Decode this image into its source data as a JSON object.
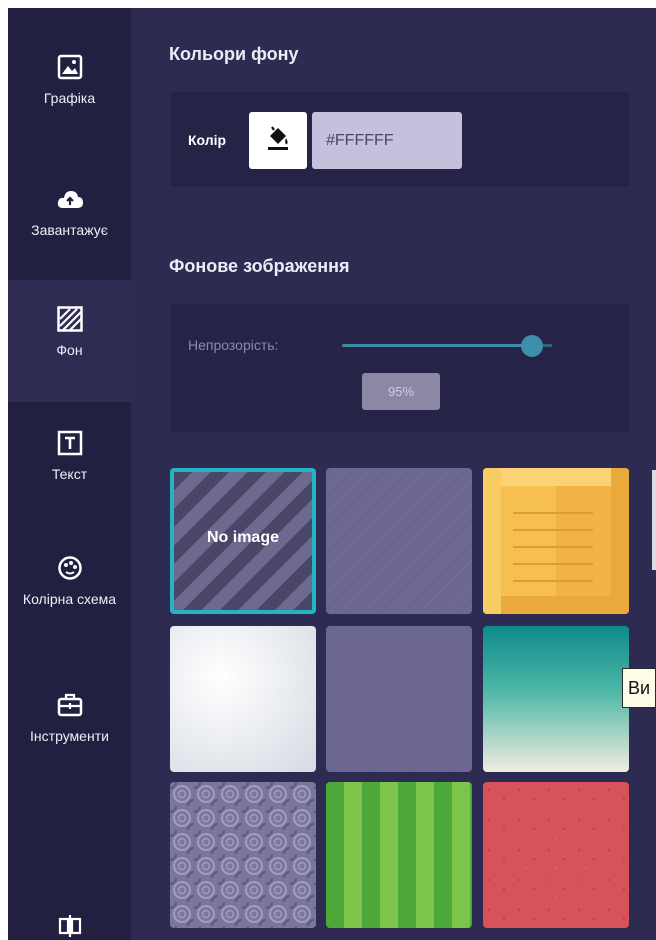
{
  "sidebar": {
    "items": [
      {
        "label": "Графіка",
        "icon": "image-icon",
        "active": false
      },
      {
        "label": "Завантажує",
        "icon": "cloud-upload-icon",
        "active": false
      },
      {
        "label": "Фон",
        "icon": "background-pattern-icon",
        "active": true
      },
      {
        "label": "Текст",
        "icon": "text-box-icon",
        "active": false
      },
      {
        "label": "Колірна схема",
        "icon": "palette-icon",
        "active": false
      },
      {
        "label": "Інструменти",
        "icon": "toolbox-icon",
        "active": false
      },
      {
        "label": "",
        "icon": "layers-icon",
        "active": false
      }
    ]
  },
  "background_colors": {
    "title": "Кольори фону",
    "color_label": "Колір",
    "fill_icon": "paint-bucket-icon",
    "hex_value": "#FFFFFF"
  },
  "background_image": {
    "title": "Фонове зображення",
    "opacity_label": "Непрозорість:",
    "opacity_value": "95%",
    "opacity_level": 0.95,
    "tiles": [
      {
        "name": "no-image",
        "label": "No image",
        "selected": true
      },
      {
        "name": "purple-diagonal"
      },
      {
        "name": "yellow-crate"
      },
      {
        "name": "white-gradient"
      },
      {
        "name": "purple-grid"
      },
      {
        "name": "teal-gradient"
      },
      {
        "name": "purple-swirl"
      },
      {
        "name": "green-stripes"
      },
      {
        "name": "red-speckle"
      }
    ]
  },
  "tooltip": {
    "text": "Ви"
  },
  "colors": {
    "sidebar_bg": "#222040",
    "panel_bg": "#2e2b52",
    "card_bg": "#252346",
    "accent_teal": "#25b4c4",
    "slider": "#3d8ba7"
  }
}
